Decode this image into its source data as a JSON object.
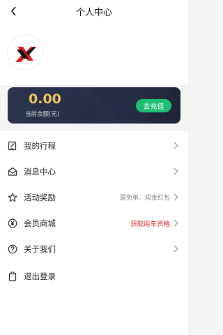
{
  "header": {
    "title": "个人中心"
  },
  "profile": {
    "nickname": ""
  },
  "balance": {
    "amount": "0.00",
    "label": "当前余额(元)",
    "recharge_label": "去充值"
  },
  "menu": {
    "items": [
      {
        "label": "我的行程",
        "extra": "",
        "icon": "document-edit-icon"
      },
      {
        "label": "消息中心",
        "extra": "",
        "icon": "envelope-icon"
      },
      {
        "label": "活动奖励",
        "extra": "赢免单、现金红包",
        "icon": "star-icon"
      },
      {
        "label": "会员商城",
        "extra": "获取用车资格",
        "icon": "yen-coin-icon"
      },
      {
        "label": "关于我们",
        "extra": "",
        "icon": "question-icon"
      },
      {
        "label": "退出登录",
        "extra": "",
        "icon": "clipboard-icon"
      }
    ]
  },
  "colors": {
    "accent_green": "#1fbf73",
    "balance_gold": "#f0c860",
    "highlight_red": "#e02a2a",
    "card_dark": "#262c44"
  }
}
